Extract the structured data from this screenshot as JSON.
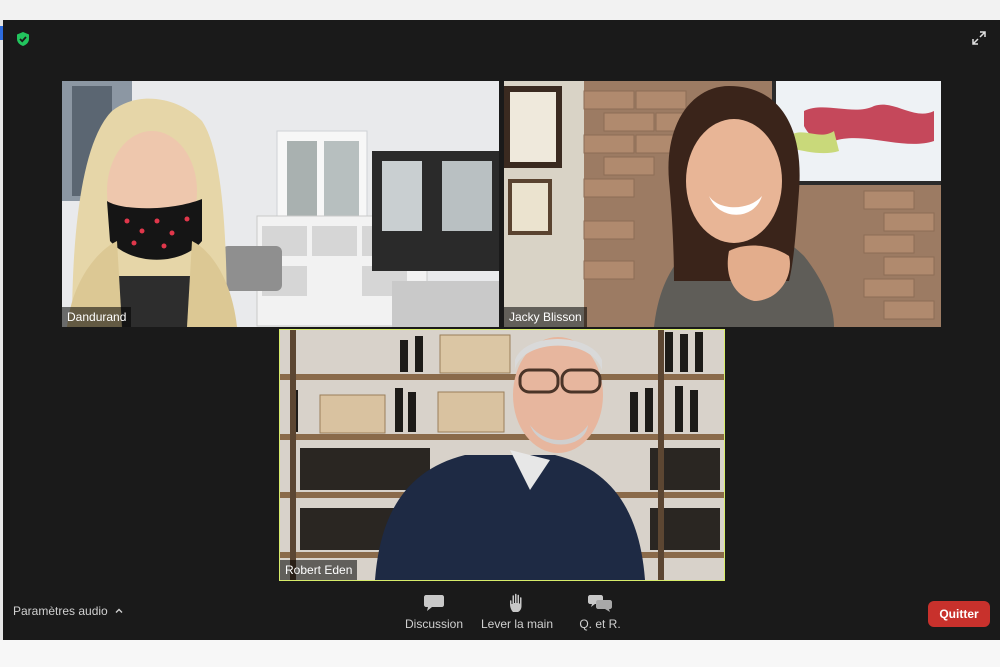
{
  "participants": [
    {
      "name": "Dandurand",
      "active_speaker": false
    },
    {
      "name": "Jacky Blisson",
      "active_speaker": false
    },
    {
      "name": "Robert Eden",
      "active_speaker": true
    }
  ],
  "toolbar": {
    "audio_settings_label": "Paramètres audio",
    "discussion_label": "Discussion",
    "raise_hand_label": "Lever la main",
    "qa_label": "Q. et R.",
    "quit_label": "Quitter"
  },
  "colors": {
    "window_background": "#1a1a1a",
    "active_speaker_border": "#d7ec6a",
    "quit_button": "#c8312c",
    "encryption_shield": "#22c55e"
  },
  "icons": {
    "encryption": "shield-check-icon",
    "fullscreen": "expand-arrows-icon",
    "audio_menu": "chevron-up-icon",
    "discussion": "chat-bubble-icon",
    "raise_hand": "hand-icon",
    "qa": "qa-bubbles-icon"
  }
}
